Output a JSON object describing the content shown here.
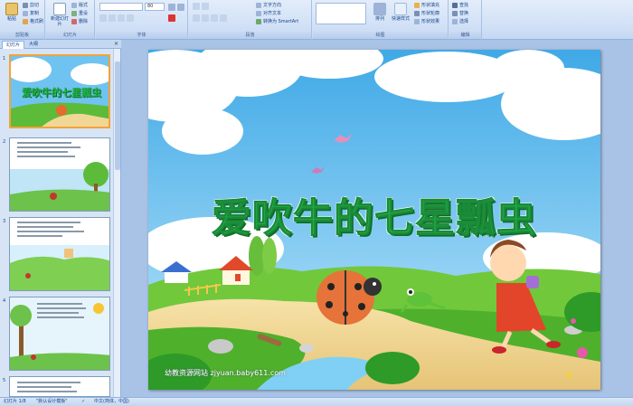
{
  "ribbon": {
    "clipboard": {
      "paste": "粘贴",
      "cut": "剪切",
      "copy": "复制",
      "format_painter": "格式刷",
      "group": "剪贴板"
    },
    "slides": {
      "new_slide": "新建幻灯片",
      "layout": "版式",
      "reset": "重设",
      "delete": "删除",
      "group": "幻灯片"
    },
    "font": {
      "font_value": "",
      "size_value": "80",
      "group": "字体"
    },
    "paragraph": {
      "text_direction": "文字方向",
      "align_text": "对齐文本",
      "smartart": "转换为 SmartArt",
      "group": "段落"
    },
    "drawing": {
      "arrange": "排列",
      "quick_styles": "快速样式",
      "shape_fill": "形状填充",
      "shape_outline": "形状轮廓",
      "shape_effects": "形状效果",
      "group": "绘图"
    },
    "editing": {
      "find": "查找",
      "replace": "替换",
      "select": "选择",
      "group": "编辑"
    }
  },
  "left_panel": {
    "tabs": [
      "幻灯片",
      "大纲"
    ],
    "close": "×",
    "slide_numbers": [
      "1",
      "2",
      "3",
      "4",
      "5"
    ],
    "thumb1_title": "爱吹牛的七星瓢虫"
  },
  "slide": {
    "title": "爱吹牛的七星瓢虫",
    "watermark": "幼教资源网站  zjyuan.baby611.com"
  },
  "status_bar": {
    "slide_info": "幻灯片 1/8",
    "theme": "\"默认设计模板\"",
    "language": "中文(简体，中国)"
  },
  "colors": {
    "title_green": "#21b04a",
    "sky": "#6fc3f0",
    "selection": "#f2a33a"
  }
}
